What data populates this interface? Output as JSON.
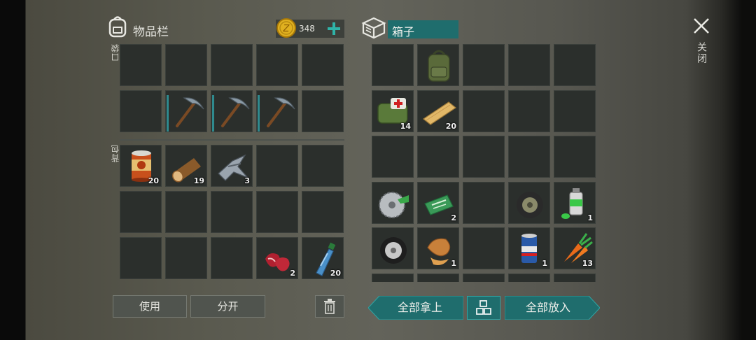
{
  "inventory": {
    "title": "物品栏",
    "coins": "348",
    "pocket_label": "口袋",
    "backpack_label": "背包",
    "pocket_slots": [
      {
        "item": "",
        "qty": ""
      },
      {
        "item": "",
        "qty": ""
      },
      {
        "item": "",
        "qty": ""
      },
      {
        "item": "",
        "qty": ""
      },
      {
        "item": "",
        "qty": ""
      },
      {
        "item": "",
        "qty": ""
      },
      {
        "item": "pickaxe",
        "qty": ""
      },
      {
        "item": "pickaxe",
        "qty": ""
      },
      {
        "item": "pickaxe",
        "qty": ""
      },
      {
        "item": "",
        "qty": ""
      }
    ],
    "backpack_slots": [
      {
        "item": "canned-food",
        "qty": "20"
      },
      {
        "item": "log",
        "qty": "19"
      },
      {
        "item": "metal-parts",
        "qty": "3"
      },
      {
        "item": "",
        "qty": ""
      },
      {
        "item": "",
        "qty": ""
      },
      {
        "item": "",
        "qty": ""
      },
      {
        "item": "",
        "qty": ""
      },
      {
        "item": "",
        "qty": ""
      },
      {
        "item": "",
        "qty": ""
      },
      {
        "item": "",
        "qty": ""
      },
      {
        "item": "",
        "qty": ""
      },
      {
        "item": "",
        "qty": ""
      },
      {
        "item": "",
        "qty": ""
      },
      {
        "item": "raw-meat",
        "qty": "2"
      },
      {
        "item": "water-bottle",
        "qty": "20"
      }
    ],
    "use_button": "使用",
    "split_button": "分开"
  },
  "box": {
    "title": "箱子",
    "slots": [
      {
        "item": "",
        "qty": ""
      },
      {
        "item": "backpack",
        "qty": ""
      },
      {
        "item": "",
        "qty": ""
      },
      {
        "item": "",
        "qty": ""
      },
      {
        "item": "",
        "qty": ""
      },
      {
        "item": "medkit-bag",
        "qty": "14"
      },
      {
        "item": "plank",
        "qty": "20"
      },
      {
        "item": "",
        "qty": ""
      },
      {
        "item": "",
        "qty": ""
      },
      {
        "item": "",
        "qty": ""
      },
      {
        "item": "",
        "qty": ""
      },
      {
        "item": "",
        "qty": ""
      },
      {
        "item": "",
        "qty": ""
      },
      {
        "item": "",
        "qty": ""
      },
      {
        "item": "",
        "qty": ""
      },
      {
        "item": "saw-blade",
        "qty": ""
      },
      {
        "item": "ration-coupon",
        "qty": "2"
      },
      {
        "item": "",
        "qty": ""
      },
      {
        "item": "tire",
        "qty": ""
      },
      {
        "item": "spray-can",
        "qty": "1"
      },
      {
        "item": "wheel",
        "qty": ""
      },
      {
        "item": "leather-scraps",
        "qty": "1"
      },
      {
        "item": "",
        "qty": ""
      },
      {
        "item": "beer-can",
        "qty": "1"
      },
      {
        "item": "carrot",
        "qty": "13"
      }
    ],
    "take_all_button": "全部拿上",
    "put_all_button": "全部放入"
  },
  "close_label": "关闭",
  "colors": {
    "teal": "#1f6d6d",
    "teal_accent": "#2f8a8e",
    "slot": "#2b2f2c",
    "coin": "#e0b020"
  }
}
